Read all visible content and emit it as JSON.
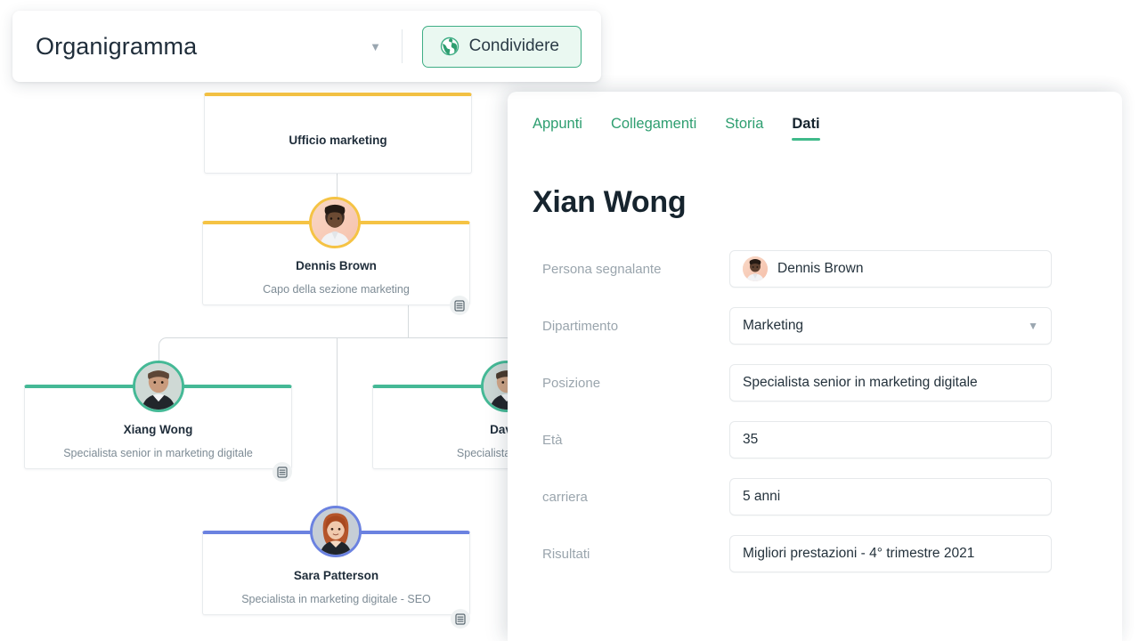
{
  "toolbar": {
    "title": "Organigramma",
    "caret_icon": "chevron-down-icon",
    "share_label": "Condividere",
    "share_icon": "globe-icon",
    "accent_green": "#3fae85",
    "share_bg": "#eaf8f1"
  },
  "chart": {
    "nodes": [
      {
        "id": "ufficio-marketing",
        "title": "Ufficio marketing",
        "subtitle": "",
        "accent": "#f5c344",
        "has_avatar": false,
        "has_db_icon": false
      },
      {
        "id": "dennis-brown",
        "title": "Dennis Brown",
        "subtitle": "Capo della sezione marketing",
        "accent": "#f5c344",
        "has_avatar": true,
        "has_db_icon": true,
        "db_icon": "database-icon"
      },
      {
        "id": "xiang-wong",
        "title": "Xiang Wong",
        "subtitle": "Specialista senior in marketing digitale",
        "accent": "#45b996",
        "has_avatar": true,
        "has_db_icon": true,
        "db_icon": "database-icon"
      },
      {
        "id": "david",
        "title": "David",
        "subtitle": "Specialista senior in",
        "accent": "#45b996",
        "has_avatar": true,
        "has_db_icon": false
      },
      {
        "id": "sara-patterson",
        "title": "Sara Patterson",
        "subtitle": "Specialista in marketing digitale - SEO",
        "accent": "#6b82e0",
        "has_avatar": true,
        "has_db_icon": true,
        "db_icon": "database-icon"
      }
    ]
  },
  "panel": {
    "tabs": [
      {
        "label": "Appunti",
        "active": false
      },
      {
        "label": "Collegamenti",
        "active": false
      },
      {
        "label": "Storia",
        "active": false
      },
      {
        "label": "Dati",
        "active": true
      }
    ],
    "person_name": "Xian Wong",
    "tab_color": "#2e9e70",
    "tab_active_color": "#16242e",
    "fields": [
      {
        "label": "Persona segnalante",
        "value": "Dennis Brown",
        "type": "person",
        "avatar_icon": "person-avatar-icon"
      },
      {
        "label": "Dipartimento",
        "value": "Marketing",
        "type": "select",
        "caret_icon": "chevron-down-icon"
      },
      {
        "label": "Posizione",
        "value": "Specialista senior in marketing digitale",
        "type": "text"
      },
      {
        "label": "Età",
        "value": "35",
        "type": "text"
      },
      {
        "label": "carriera",
        "value": "5 anni",
        "type": "text"
      },
      {
        "label": "Risultati",
        "value": "Migliori prestazioni - 4° trimestre 2021",
        "type": "text"
      }
    ]
  }
}
